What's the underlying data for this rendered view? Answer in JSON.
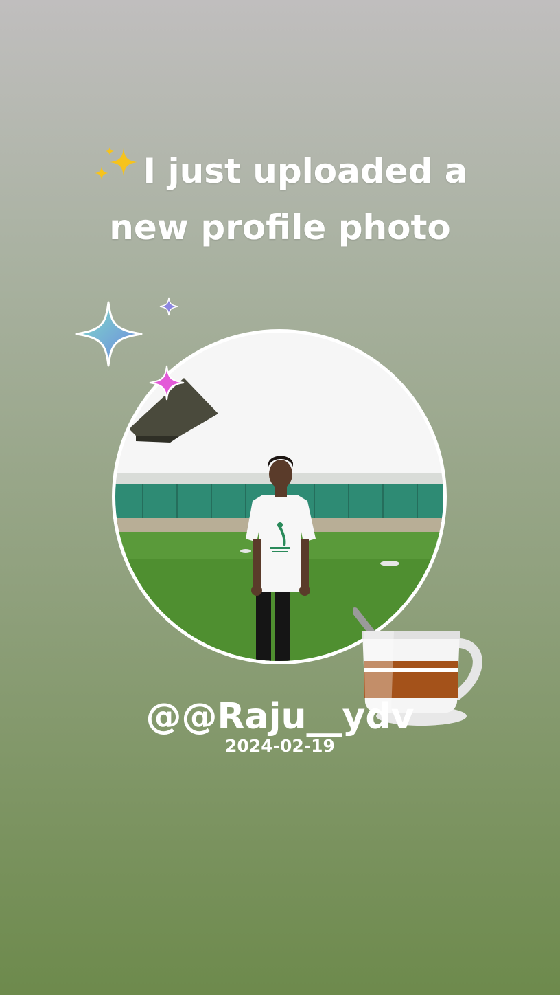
{
  "story": {
    "headline_line1": "I just uploaded a",
    "headline_line2": "new profile photo",
    "headline_emoji": "sparkles-emoji",
    "username": "@@Raju__ydv",
    "date": "2024-02-19"
  },
  "decorations": {
    "sparkle_large_color": "#5fc3d8",
    "sparkle_small_color": "#8c86e0",
    "sparkle_pink_color": "#e35ad8",
    "cup": "coffee-cup-icon"
  },
  "colors": {
    "text": "#ffffff",
    "background_top": "#c0bebe",
    "background_bottom": "#6d8a4c"
  }
}
